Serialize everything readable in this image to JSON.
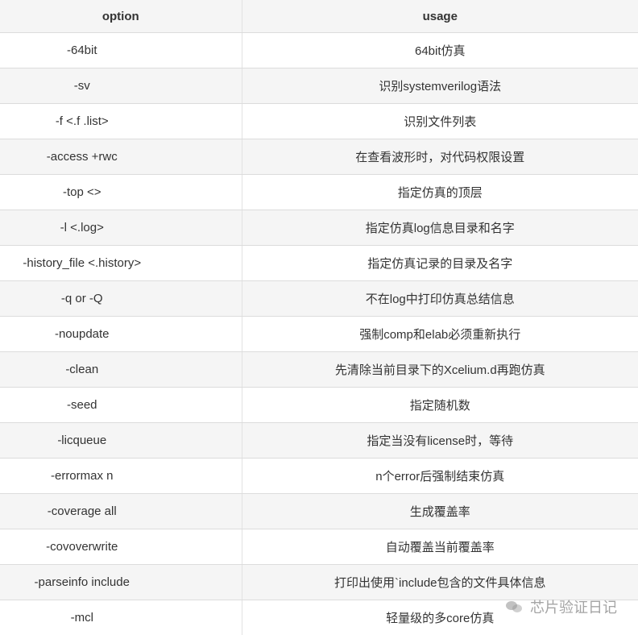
{
  "table": {
    "headers": {
      "option": "option",
      "usage": "usage"
    },
    "rows": [
      {
        "option": "-64bit",
        "usage": "64bit仿真"
      },
      {
        "option": "-sv",
        "usage": "识别systemverilog语法"
      },
      {
        "option": "-f <.f .list>",
        "usage": "识别文件列表"
      },
      {
        "option": "-access +rwc",
        "usage": "在查看波形时，对代码权限设置"
      },
      {
        "option": "-top <>",
        "usage": "指定仿真的顶层"
      },
      {
        "option": "-l <.log>",
        "usage": "指定仿真log信息目录和名字"
      },
      {
        "option": "-history_file <.history>",
        "usage": "指定仿真记录的目录及名字"
      },
      {
        "option": "-q or -Q",
        "usage": "不在log中打印仿真总结信息"
      },
      {
        "option": "-noupdate",
        "usage": "强制comp和elab必须重新执行"
      },
      {
        "option": "-clean",
        "usage": "先清除当前目录下的Xcelium.d再跑仿真"
      },
      {
        "option": "-seed",
        "usage": "指定随机数"
      },
      {
        "option": "-licqueue",
        "usage": "指定当没有license时，等待"
      },
      {
        "option": "-errormax n",
        "usage": "n个error后强制结束仿真"
      },
      {
        "option": "-coverage all",
        "usage": "生成覆盖率"
      },
      {
        "option": "-covoverwrite",
        "usage": "自动覆盖当前覆盖率"
      },
      {
        "option": "-parseinfo include",
        "usage": "打印出使用`include包含的文件具体信息"
      },
      {
        "option": "-mcl",
        "usage": "轻量级的多core仿真"
      }
    ]
  },
  "watermark": {
    "text": "芯片验证日记",
    "icon": "wechat-icon"
  }
}
